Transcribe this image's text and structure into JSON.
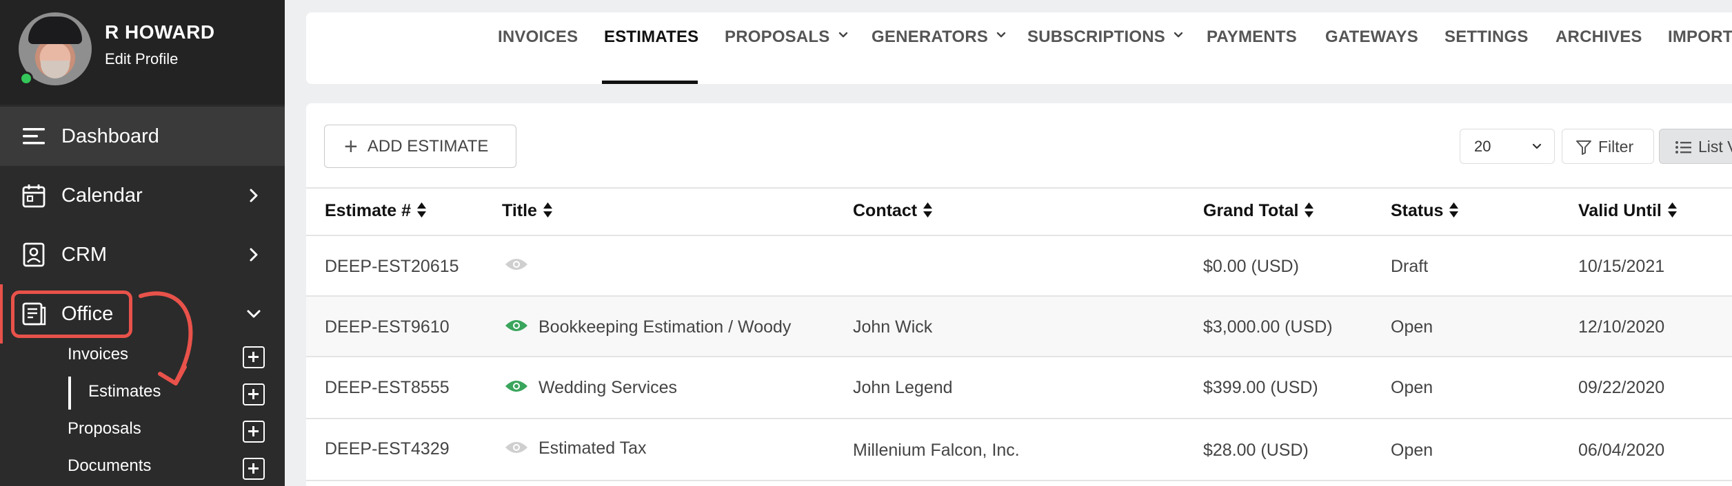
{
  "profile": {
    "name": "R HOWARD",
    "edit_label": "Edit Profile"
  },
  "sidebar": {
    "nav": [
      {
        "label": "Dashboard",
        "icon": "menu-icon"
      },
      {
        "label": "Calendar",
        "icon": "calendar-icon"
      },
      {
        "label": "CRM",
        "icon": "contact-card-icon"
      },
      {
        "label": "Office",
        "icon": "office-document-icon"
      }
    ],
    "office_sub": [
      {
        "label": "Invoices"
      },
      {
        "label": "Estimates"
      },
      {
        "label": "Proposals"
      },
      {
        "label": "Documents"
      }
    ]
  },
  "tabs": [
    {
      "label": "INVOICES"
    },
    {
      "label": "ESTIMATES"
    },
    {
      "label": "PROPOSALS"
    },
    {
      "label": "GENERATORS"
    },
    {
      "label": "SUBSCRIPTIONS"
    },
    {
      "label": "PAYMENTS"
    },
    {
      "label": "GATEWAYS"
    },
    {
      "label": "SETTINGS"
    },
    {
      "label": "ARCHIVES"
    },
    {
      "label": "IMPORT"
    }
  ],
  "toolbar": {
    "add_label": "ADD ESTIMATE",
    "per_page": "20",
    "filter_label": "Filter",
    "list_view_label": "List V"
  },
  "table": {
    "headers": [
      "Estimate #",
      "Title",
      "Contact",
      "Grand Total",
      "Status",
      "Valid Until"
    ],
    "rows": [
      {
        "number": "DEEP-EST20615",
        "title": "",
        "viewed": false,
        "contact": "",
        "total": "$0.00 (USD)",
        "status": "Draft",
        "valid_until": "10/15/2021"
      },
      {
        "number": "DEEP-EST9610",
        "title": "Bookkeeping Estimation / Woody",
        "viewed": true,
        "contact": "John Wick",
        "total": "$3,000.00 (USD)",
        "status": "Open",
        "valid_until": "12/10/2020"
      },
      {
        "number": "DEEP-EST8555",
        "title": "Wedding Services",
        "viewed": true,
        "contact": "John Legend",
        "total": "$399.00 (USD)",
        "status": "Open",
        "valid_until": "09/22/2020"
      },
      {
        "number": "DEEP-EST4329",
        "title": "Estimated Tax",
        "viewed": false,
        "contact": "Millenium Falcon, Inc.",
        "total": "$28.00 (USD)",
        "status": "Open",
        "valid_until": "06/04/2020"
      }
    ]
  },
  "colors": {
    "sidebar_bg": "#2b2b2b",
    "highlight_red": "#e8524a",
    "eye_viewed": "#3aa55c",
    "eye_unviewed": "#cfcfcf",
    "online_green": "#34c759"
  }
}
